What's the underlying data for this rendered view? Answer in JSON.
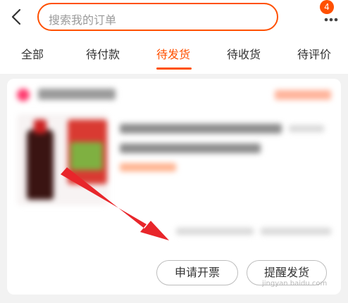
{
  "header": {
    "search_placeholder": "搜索我的订单",
    "badge_count": "4"
  },
  "tabs": [
    {
      "label": "全部",
      "active": false
    },
    {
      "label": "待付款",
      "active": false
    },
    {
      "label": "待发货",
      "active": true
    },
    {
      "label": "待收货",
      "active": false
    },
    {
      "label": "待评价",
      "active": false
    }
  ],
  "order_card": {
    "actions": {
      "invoice_label": "申请开票",
      "remind_label": "提醒发货"
    }
  },
  "colors": {
    "accent": "#ff5000",
    "arrow": "#e8262b"
  },
  "icons": {
    "back": "back-arrow-icon",
    "more": "more-dots-icon"
  }
}
